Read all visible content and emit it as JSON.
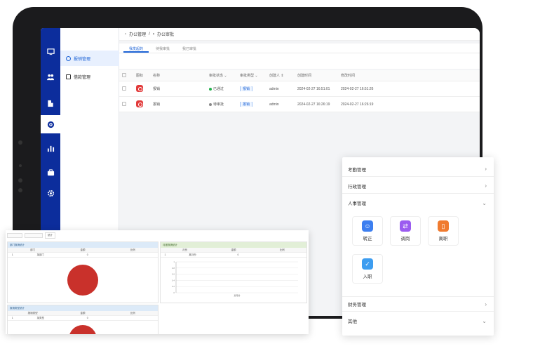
{
  "breadcrumb": {
    "home": "办公管理",
    "current": "办公审批"
  },
  "rail": {
    "icons": [
      "monitor-icon",
      "users-icon",
      "building-icon",
      "target-icon",
      "bar-chart-icon",
      "briefcase-icon",
      "gear-icon"
    ],
    "active_index": 3
  },
  "submenu": {
    "items": [
      {
        "label": "报销管理",
        "icon": "target-icon"
      },
      {
        "label": "借款管理",
        "icon": "plus-square-icon"
      }
    ],
    "active_index": 0
  },
  "tabs": [
    {
      "label": "我发起的"
    },
    {
      "label": "待我审批"
    },
    {
      "label": "我已审批"
    }
  ],
  "table": {
    "headers": {
      "icon": "图标",
      "name": "名称",
      "status": "审批状态",
      "type": "审批类型",
      "creator": "创建人",
      "created": "创建时间",
      "modified": "修改时间"
    },
    "rows": [
      {
        "name": "报销",
        "status": "已通过",
        "status_color": "#22b14c",
        "type": "报销",
        "creator": "admin",
        "created": "2024-02-27 16:51:01",
        "modified": "2024-02-27 16:51:26"
      },
      {
        "name": "报销",
        "status": "待审批",
        "status_color": "#888888",
        "type": "报销",
        "creator": "admin",
        "created": "2024-02-27 16:26:19",
        "modified": "2024-02-27 16:26:19"
      }
    ]
  },
  "report": {
    "filter_button": "统计",
    "cards": [
      {
        "title": "部门报销统计",
        "cols": [
          "部门",
          "金额",
          "比例"
        ],
        "row": [
          "1",
          "某部门",
          "0"
        ]
      },
      {
        "title": "月度报销统计",
        "cols": [
          "月份",
          "金额",
          "比例"
        ],
        "row": [
          "1",
          "某月份",
          "0"
        ]
      },
      {
        "title": "报销类型统计",
        "cols": [
          "报销类型",
          "金额",
          "比例"
        ],
        "row": [
          "1",
          "某类型",
          "0"
        ]
      }
    ],
    "chart_data": [
      {
        "type": "pie",
        "values": [
          100
        ],
        "colors": [
          "#c9312b"
        ]
      },
      {
        "type": "bar",
        "ylim": [
          0,
          1
        ],
        "ticks": [
          "1",
          "0.8",
          "0.6",
          "0.4",
          "0.2",
          "0"
        ],
        "categories": [
          "某月份"
        ],
        "values": [
          0
        ]
      },
      {
        "type": "pie",
        "values": [
          100
        ],
        "colors": [
          "#c9312b"
        ]
      }
    ]
  },
  "menu_card": {
    "sections": [
      {
        "label": "考勤管理",
        "expanded": false
      },
      {
        "label": "行政管理",
        "expanded": false
      },
      {
        "label": "人事管理",
        "expanded": true
      },
      {
        "label": "财务管理",
        "expanded": false
      },
      {
        "label": "其他",
        "expanded": true
      }
    ],
    "tiles": [
      {
        "label": "转正",
        "color": "#3d7ff0",
        "icon": "person-icon"
      },
      {
        "label": "调岗",
        "color": "#9b5cf0",
        "icon": "swap-icon"
      },
      {
        "label": "离职",
        "color": "#f07b2f",
        "icon": "exit-icon"
      },
      {
        "label": "入职",
        "color": "#3d9df0",
        "icon": "check-icon"
      }
    ]
  }
}
